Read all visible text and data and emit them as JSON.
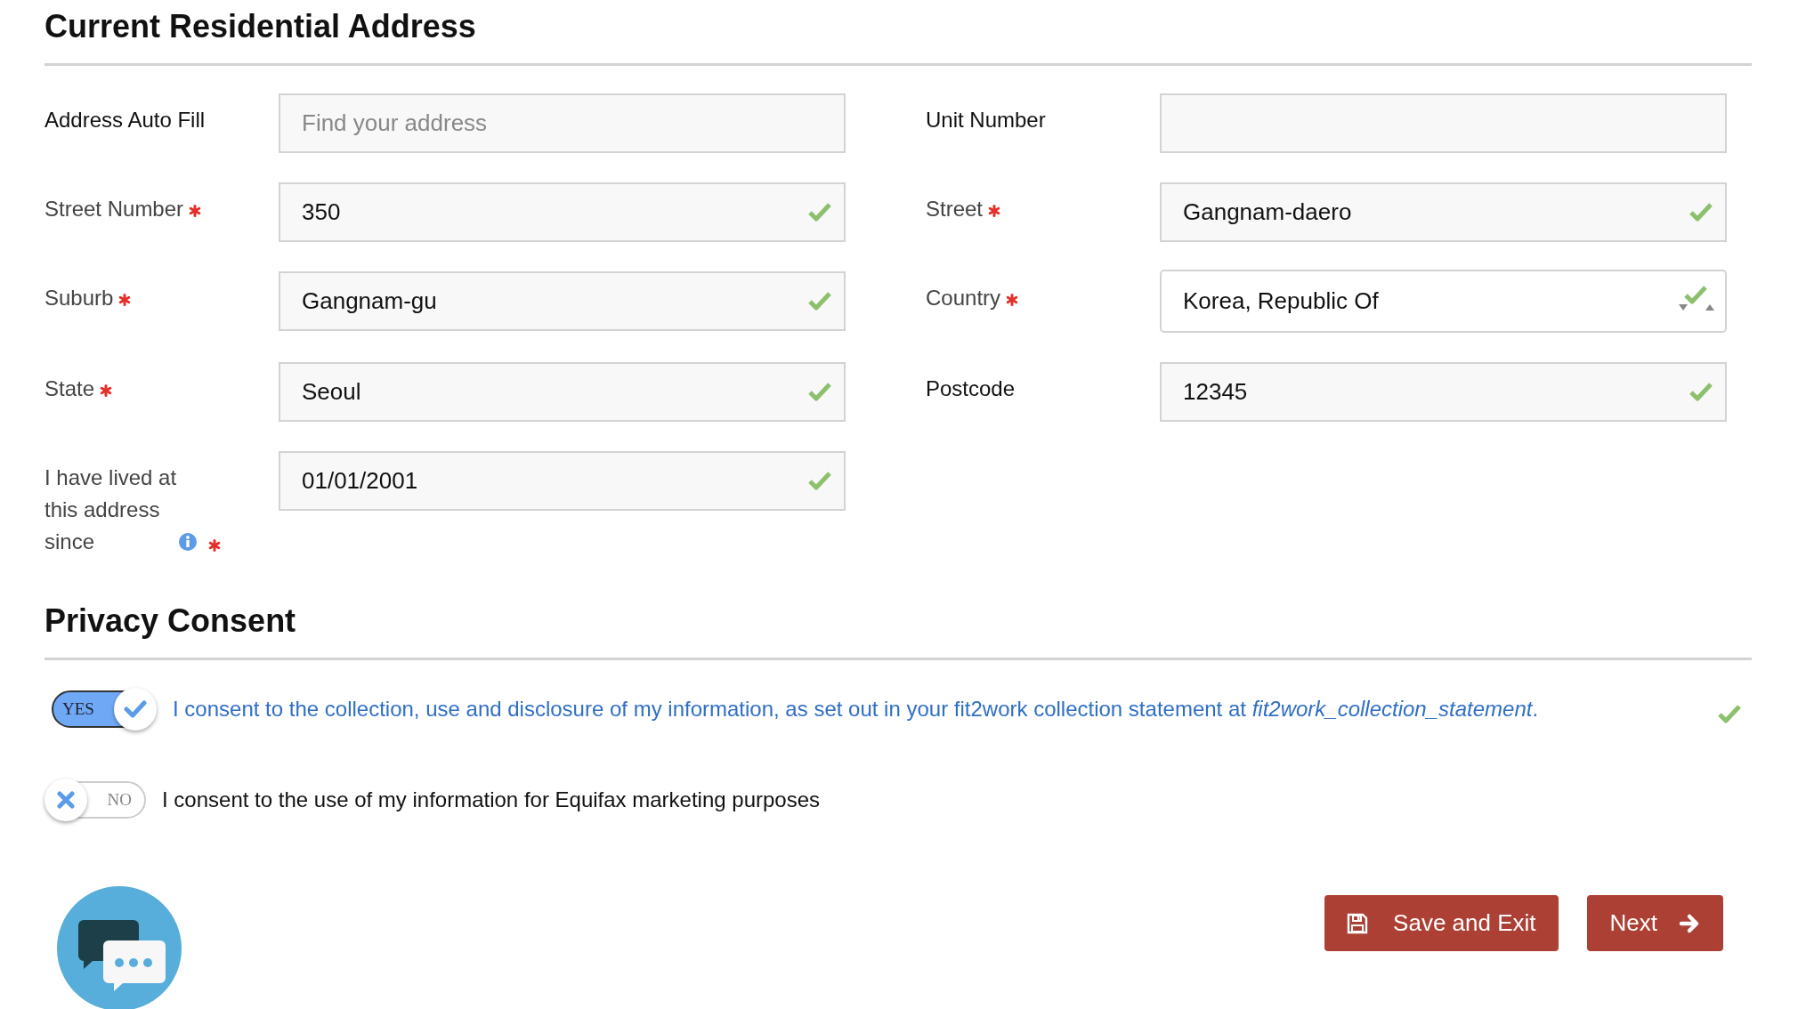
{
  "address_section": {
    "title": "Current Residential Address",
    "fields": [
      {
        "label": "Address Auto Fill",
        "kind": "text",
        "placeholder": "Find your address"
      },
      {
        "label": "Unit Number",
        "kind": "text"
      },
      {
        "label": "Street Number",
        "kind": "text",
        "required": true,
        "value": "350",
        "valid": true
      },
      {
        "label": "Street",
        "kind": "text",
        "required": true,
        "value": "Gangnam-daero",
        "valid": true
      },
      {
        "label": "Suburb",
        "kind": "text",
        "required": true,
        "value": "Gangnam-gu",
        "valid": true
      },
      {
        "label": "Country",
        "kind": "select",
        "required": true,
        "value": "Korea, Republic Of",
        "valid": true
      },
      {
        "label": "State",
        "kind": "text",
        "required": true,
        "value": "Seoul",
        "valid": true
      },
      {
        "label": "Postcode",
        "kind": "text",
        "value": "12345",
        "valid": true
      },
      {
        "label": "I have lived at this address since",
        "kind": "text",
        "required": true,
        "info": true,
        "value": "01/01/2001",
        "valid": true
      }
    ]
  },
  "privacy_section": {
    "title": "Privacy Consent",
    "consents": [
      {
        "on": true,
        "toggle_label": "YES",
        "text": "I consent to the collection, use and disclosure of my information, as set out in your fit2work collection statement at",
        "link": "fit2work_collection_statement",
        "after": ".",
        "valid": true
      },
      {
        "on": false,
        "toggle_label": "NO",
        "text": "I consent to the use of my information for Equifax marketing purposes"
      }
    ]
  },
  "buttons": [
    {
      "kind": "save",
      "label": "Save and Exit"
    },
    {
      "kind": "next",
      "label": "Next"
    }
  ]
}
